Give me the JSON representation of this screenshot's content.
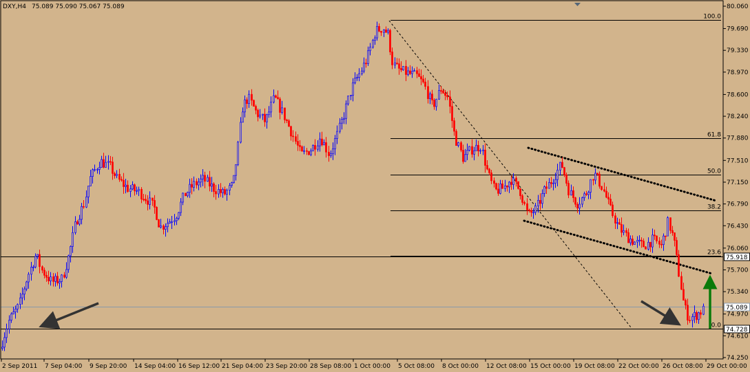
{
  "header": {
    "symbol": "DXY,H4",
    "ohlc": "75.089 75.090 75.067 75.089"
  },
  "chart_data": {
    "type": "candlestick",
    "symbol": "DXY",
    "timeframe": "H4",
    "ylim": [
      74.25,
      80.06
    ],
    "price_ticks": [
      "80.060",
      "79.690",
      "79.330",
      "78.970",
      "78.600",
      "78.240",
      "77.880",
      "77.510",
      "77.150",
      "76.790",
      "76.430",
      "76.060",
      "75.700",
      "75.340",
      "74.970",
      "74.610",
      "74.250"
    ],
    "time_labels": [
      "2 Sep 2011",
      "7 Sep 04:00",
      "9 Sep 20:00",
      "14 Sep 04:00",
      "16 Sep 12:00",
      "21 Sep 04:00",
      "23 Sep 20:00",
      "28 Sep 08:00",
      "1 Oct 00:00",
      "5 Oct 08:00",
      "8 Oct 00:00",
      "12 Oct 08:00",
      "15 Oct 00:00",
      "19 Oct 08:00",
      "22 Oct 00:00",
      "26 Oct 08:00",
      "29 Oct 00:00"
    ],
    "current_price": "75.089",
    "horizontal_levels": [
      {
        "label": "75.918",
        "value": 75.918
      },
      {
        "label": "74.728",
        "value": 74.728
      }
    ],
    "fibonacci": [
      {
        "label": "100.0",
        "value": 79.83
      },
      {
        "label": "61.8",
        "value": 77.88
      },
      {
        "label": "50.0",
        "value": 77.28
      },
      {
        "label": "38.2",
        "value": 76.68
      },
      {
        "label": "23.6",
        "value": 75.93
      },
      {
        "label": "0.0",
        "value": 74.73
      }
    ],
    "key_points": [
      {
        "x": 0,
        "y": 74.4
      },
      {
        "x": 12,
        "y": 74.85
      },
      {
        "x": 27,
        "y": 75.1
      },
      {
        "x": 40,
        "y": 75.6
      },
      {
        "x": 52,
        "y": 75.95
      },
      {
        "x": 60,
        "y": 75.7
      },
      {
        "x": 75,
        "y": 75.5
      },
      {
        "x": 90,
        "y": 75.55
      },
      {
        "x": 100,
        "y": 75.95
      },
      {
        "x": 110,
        "y": 76.5
      },
      {
        "x": 122,
        "y": 76.8
      },
      {
        "x": 130,
        "y": 77.2
      },
      {
        "x": 145,
        "y": 77.5
      },
      {
        "x": 160,
        "y": 77.4
      },
      {
        "x": 170,
        "y": 77.2
      },
      {
        "x": 185,
        "y": 77.05
      },
      {
        "x": 200,
        "y": 77.0
      },
      {
        "x": 215,
        "y": 76.85
      },
      {
        "x": 225,
        "y": 76.7
      },
      {
        "x": 232,
        "y": 76.4
      },
      {
        "x": 245,
        "y": 76.5
      },
      {
        "x": 255,
        "y": 76.6
      },
      {
        "x": 268,
        "y": 76.95
      },
      {
        "x": 280,
        "y": 77.1
      },
      {
        "x": 295,
        "y": 77.2
      },
      {
        "x": 310,
        "y": 77.05
      },
      {
        "x": 325,
        "y": 76.95
      },
      {
        "x": 338,
        "y": 77.1
      },
      {
        "x": 345,
        "y": 77.7
      },
      {
        "x": 352,
        "y": 78.4
      },
      {
        "x": 360,
        "y": 78.55
      },
      {
        "x": 372,
        "y": 78.3
      },
      {
        "x": 385,
        "y": 78.15
      },
      {
        "x": 398,
        "y": 78.55
      },
      {
        "x": 410,
        "y": 78.3
      },
      {
        "x": 422,
        "y": 78.0
      },
      {
        "x": 437,
        "y": 77.6
      },
      {
        "x": 452,
        "y": 77.7
      },
      {
        "x": 465,
        "y": 77.9
      },
      {
        "x": 478,
        "y": 77.6
      },
      {
        "x": 490,
        "y": 77.95
      },
      {
        "x": 500,
        "y": 78.3
      },
      {
        "x": 510,
        "y": 78.7
      },
      {
        "x": 522,
        "y": 78.95
      },
      {
        "x": 533,
        "y": 79.2
      },
      {
        "x": 545,
        "y": 79.65
      },
      {
        "x": 556,
        "y": 79.7
      },
      {
        "x": 563,
        "y": 79.6
      },
      {
        "x": 570,
        "y": 79.1
      },
      {
        "x": 580,
        "y": 79.0
      },
      {
        "x": 592,
        "y": 78.95
      },
      {
        "x": 605,
        "y": 78.9
      },
      {
        "x": 616,
        "y": 78.75
      },
      {
        "x": 628,
        "y": 78.4
      },
      {
        "x": 640,
        "y": 78.7
      },
      {
        "x": 650,
        "y": 78.55
      },
      {
        "x": 660,
        "y": 77.9
      },
      {
        "x": 672,
        "y": 77.55
      },
      {
        "x": 685,
        "y": 77.7
      },
      {
        "x": 698,
        "y": 77.75
      },
      {
        "x": 708,
        "y": 77.3
      },
      {
        "x": 718,
        "y": 77.0
      },
      {
        "x": 730,
        "y": 77.05
      },
      {
        "x": 742,
        "y": 77.2
      },
      {
        "x": 755,
        "y": 77.0
      },
      {
        "x": 766,
        "y": 76.6
      },
      {
        "x": 778,
        "y": 76.7
      },
      {
        "x": 790,
        "y": 77.0
      },
      {
        "x": 802,
        "y": 77.2
      },
      {
        "x": 815,
        "y": 77.45
      },
      {
        "x": 826,
        "y": 77.0
      },
      {
        "x": 838,
        "y": 76.8
      },
      {
        "x": 850,
        "y": 76.95
      },
      {
        "x": 862,
        "y": 77.3
      },
      {
        "x": 875,
        "y": 77.05
      },
      {
        "x": 886,
        "y": 76.7
      },
      {
        "x": 898,
        "y": 76.4
      },
      {
        "x": 910,
        "y": 76.25
      },
      {
        "x": 922,
        "y": 76.15
      },
      {
        "x": 935,
        "y": 76.1
      },
      {
        "x": 948,
        "y": 76.2
      },
      {
        "x": 960,
        "y": 76.1
      },
      {
        "x": 970,
        "y": 76.5
      },
      {
        "x": 978,
        "y": 76.2
      },
      {
        "x": 986,
        "y": 75.6
      },
      {
        "x": 993,
        "y": 75.1
      },
      {
        "x": 1000,
        "y": 74.9
      },
      {
        "x": 1010,
        "y": 74.95
      },
      {
        "x": 1022,
        "y": 75.05
      }
    ]
  }
}
